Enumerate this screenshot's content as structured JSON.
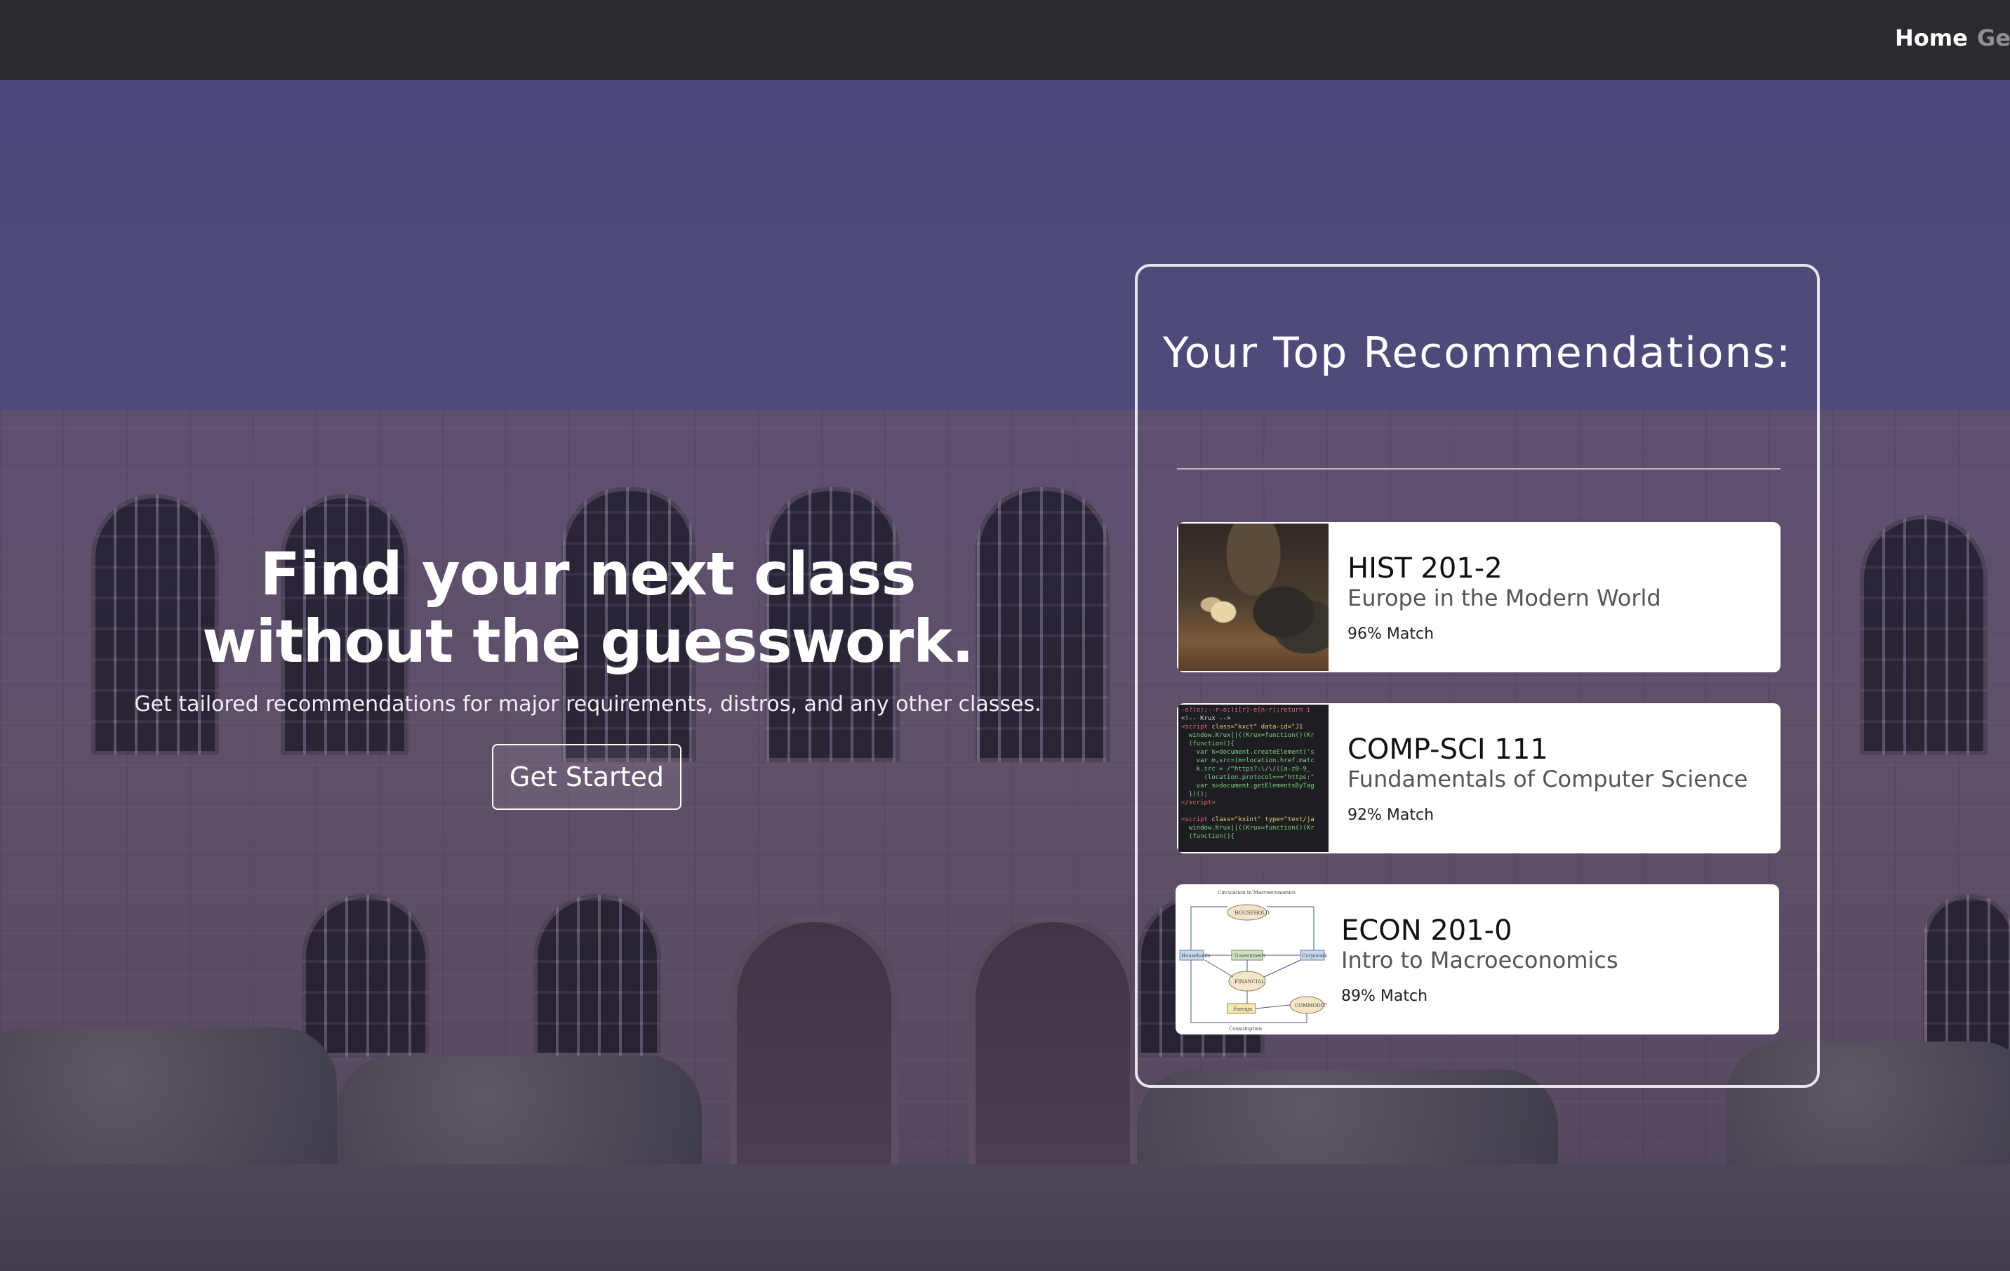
{
  "nav": {
    "home": "Home",
    "get_cut": "Get"
  },
  "hero": {
    "title": "Find your next class without the guesswork.",
    "subtitle": "Get tailored recommendations for major requirements, distros, and any other classes.",
    "cta": "Get Started"
  },
  "recommendations": {
    "title": "Your Top Recommendations:",
    "items": [
      {
        "code": "HIST 201-2",
        "name": "Europe in the Modern World",
        "match": "96% Match",
        "thumbnail": "historical-painting"
      },
      {
        "code": "COMP-SCI 111",
        "name": "Fundamentals of Computer Science",
        "match": "92% Match",
        "thumbnail": "source-code"
      },
      {
        "code": "ECON 201-0",
        "name": "Intro to Macroeconomics",
        "match": "89% Match",
        "thumbnail": "macroeconomics-diagram"
      }
    ]
  },
  "colors": {
    "navbar": "#2b2a2e",
    "overlay": "#4c4a7a",
    "card_bg": "#ffffff",
    "text_light": "#ffffff"
  }
}
